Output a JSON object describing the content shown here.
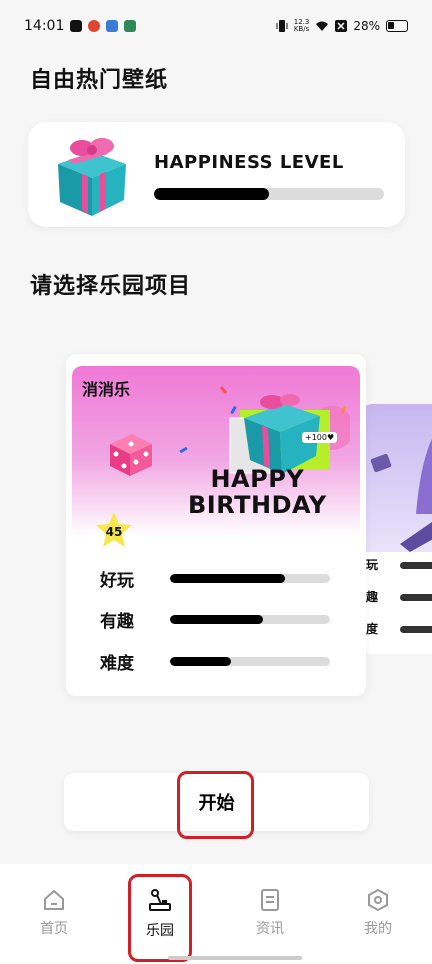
{
  "status_bar": {
    "time": "14:01",
    "net_speed_value": "12.3",
    "net_speed_unit": "KB/s",
    "battery": "28%"
  },
  "page": {
    "title": "自由热门壁纸",
    "section_title": "请选择乐园项目"
  },
  "happiness": {
    "label": "HAPPINESS LEVEL",
    "level": 0.5
  },
  "game_card": {
    "name": "消消乐",
    "banner_text_line1": "HAPPY",
    "banner_text_line2": "BIRTHDAY",
    "banner_tag": "+100♥",
    "score": "45",
    "stats": [
      {
        "label": "好玩",
        "value": 0.72
      },
      {
        "label": "有趣",
        "value": 0.58
      },
      {
        "label": "难度",
        "value": 0.38
      }
    ]
  },
  "side_card": {
    "row_labels": [
      "玩",
      "趣",
      "度"
    ]
  },
  "start_button": {
    "label": "开始"
  },
  "tabs": [
    {
      "label": "首页",
      "icon": "home-icon"
    },
    {
      "label": "乐园",
      "icon": "joystick-icon"
    },
    {
      "label": "资讯",
      "icon": "document-icon"
    },
    {
      "label": "我的",
      "icon": "hexagon-icon"
    }
  ]
}
